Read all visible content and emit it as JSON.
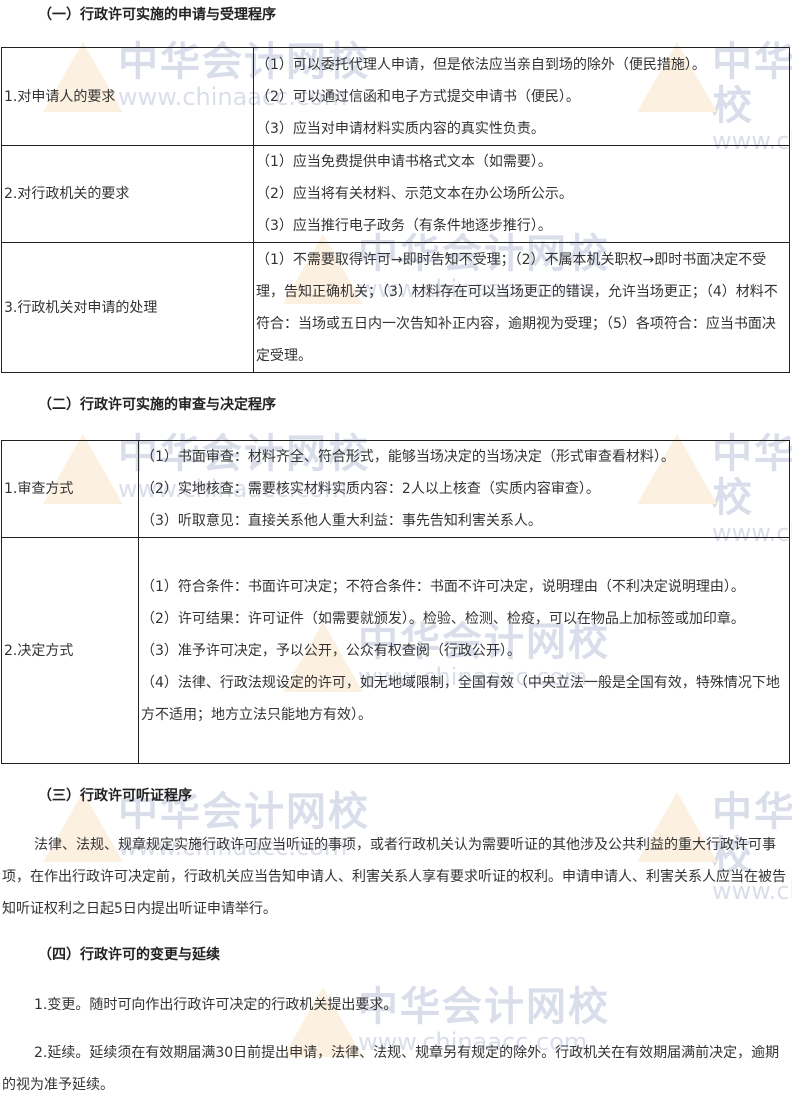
{
  "watermark": {
    "cn": "中华会计网校",
    "en": "www.chinaacc.com"
  },
  "section1": {
    "heading": "（一）行政许可实施的申请与受理程序",
    "rows": [
      {
        "label": "1.对申请人的要求",
        "items": [
          "（1）可以委托代理人申请，但是依法应当亲自到场的除外（便民措施）。",
          "（2）可以通过信函和电子方式提交申请书（便民）。",
          "（3）应当对申请材料实质内容的真实性负责。"
        ]
      },
      {
        "label": "2.对行政机关的要求",
        "items": [
          "（1）应当免费提供申请书格式文本（如需要）。",
          "（2）应当将有关材料、示范文本在办公场所公示。",
          "（3）应当推行电子政务（有条件地逐步推行）。"
        ]
      },
      {
        "label": "3.行政机关对申请的处理",
        "items": [
          "（1）不需要取得许可→即时告知不受理；（2）不属本机关职权→即时书面决定不受理，告知正确机关；（3）材料存在可以当场更正的错误，允许当场更正；（4）材料不符合：当场或五日内一次告知补正内容，逾期视为受理；（5）各项符合：应当书面决定受理。"
        ]
      }
    ]
  },
  "section2": {
    "heading": "（二）行政许可实施的审查与决定程序",
    "rows": [
      {
        "label": "1.审查方式",
        "items": [
          "（1）书面审查：材料齐全、符合形式，能够当场决定的当场决定（形式审查看材料）。",
          "（2）实地核查：需要核实材料实质内容：2人以上核查（实质内容审查）。",
          "（3）听取意见：直接关系他人重大利益：事先告知利害关系人。"
        ]
      },
      {
        "label": "2.决定方式",
        "items": [
          "（1）符合条件：书面许可决定；不符合条件：书面不许可决定，说明理由（不利决定说明理由）。",
          "（2）许可结果：许可证件（如需要就颁发）。检验、检测、检疫，可以在物品上加标签或加印章。",
          "（3）准予许可决定，予以公开，公众有权查阅（行政公开）。",
          "（4）法律、行政法规设定的许可，如无地域限制，全国有效（中央立法一般是全国有效，特殊情况下地方不适用；地方立法只能地方有效）。"
        ]
      }
    ]
  },
  "section3": {
    "heading": "（三）行政许可听证程序",
    "text": "法律、法规、规章规定实施行政许可应当听证的事项，或者行政机关认为需要听证的其他涉及公共利益的重大行政许可事项，在作出行政许可决定前，行政机关应当告知申请人、利害关系人享有要求听证的权利。申请申请人、利害关系人应当在被告知听证权利之日起5日内提出听证申请举行。"
  },
  "section4": {
    "heading": "（四）行政许可的变更与延续",
    "items": [
      "1.变更。随时可向作出行政许可决定的行政机关提出要求。",
      "2.延续。延续须在有效期届满30日前提出申请，法律、法规、规章另有规定的除外。行政机关在有效期届满前决定，逾期的视为准予延续。"
    ]
  }
}
